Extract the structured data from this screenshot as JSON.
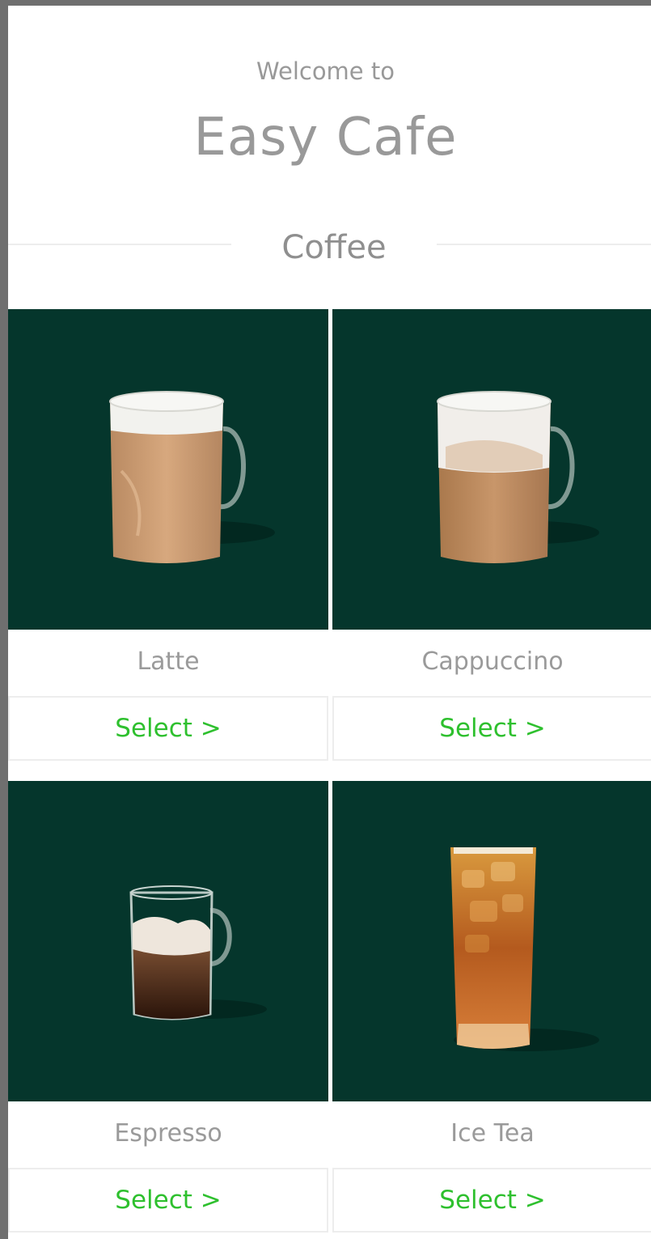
{
  "header": {
    "welcome": "Welcome to",
    "title": "Easy Cafe"
  },
  "section": {
    "title": "Coffee"
  },
  "products": [
    {
      "name": "Latte",
      "select_label": "Select >",
      "image": "latte-mug"
    },
    {
      "name": "Cappuccino",
      "select_label": "Select >",
      "image": "cappuccino-mug"
    },
    {
      "name": "Espresso",
      "select_label": "Select >",
      "image": "espresso-glass"
    },
    {
      "name": "Ice Tea",
      "select_label": "Select >",
      "image": "ice-tea-glass"
    }
  ],
  "colors": {
    "photo_background": "#05362c",
    "select_text": "#2ec02e",
    "text_gray": "#999999"
  }
}
